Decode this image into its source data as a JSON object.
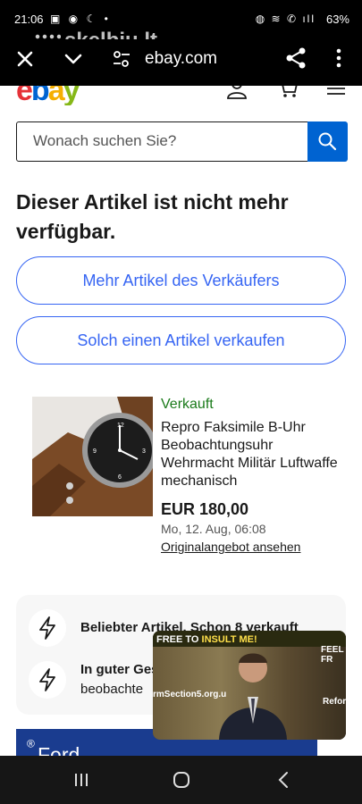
{
  "status_bar": {
    "time": "21:06",
    "battery": "63%"
  },
  "watermark": {
    "text": "skelbiu.lt"
  },
  "browser": {
    "url": "ebay.com",
    "close_icon": "close-icon",
    "menu_icon": "chevron-down-icon",
    "site_settings_icon": "tune-icon",
    "share_icon": "share-icon",
    "more_icon": "more-vert-icon"
  },
  "ebay_header": {
    "logo_letters": [
      "e",
      "b",
      "a",
      "y"
    ],
    "logo_colors": [
      "#e53238",
      "#0064d2",
      "#f5af02",
      "#86b817"
    ],
    "icons": [
      "account-icon",
      "cart-icon",
      "menu-icon"
    ]
  },
  "search": {
    "placeholder": "Wonach suchen Sie?",
    "button_icon": "search-icon"
  },
  "headline": "Dieser Artikel ist nicht mehr verfügbar.",
  "actions": {
    "more_from_seller": "Mehr Artikel des Verkäufers",
    "sell_similar": "Solch einen Artikel verkaufen"
  },
  "item": {
    "status": "Verkauft",
    "title": "Repro Faksimile B-Uhr Beobachtungsuhr Wehrmacht Militär Luftwaffe mechanisch",
    "price": "EUR 180,00",
    "date": "Mo, 12. Aug, 06:08",
    "original_listing_link": "Originalangebot ansehen"
  },
  "info": [
    {
      "icon": "lightning-icon",
      "text": "Beliebter Artikel. Schon 8 verkauft"
    },
    {
      "icon": "lightning-icon",
      "line1": "In guter Ges",
      "line2": "beobachte"
    }
  ],
  "ad": {
    "text": "Ford Transit Custom",
    "mark": "®"
  },
  "video": {
    "banner_text": "FREE TO",
    "banner_highlight": "INSULT ME!",
    "banner_right": "FEEL FR",
    "caption_left": "rmSection5.org.u",
    "caption_right": "Reform"
  },
  "nav_bar": {
    "buttons": [
      "recent-apps-icon",
      "home-icon",
      "back-icon"
    ]
  },
  "colors": {
    "accent_blue": "#3665f3",
    "search_button": "#0063d1",
    "sold_green": "#1a7a1a"
  }
}
